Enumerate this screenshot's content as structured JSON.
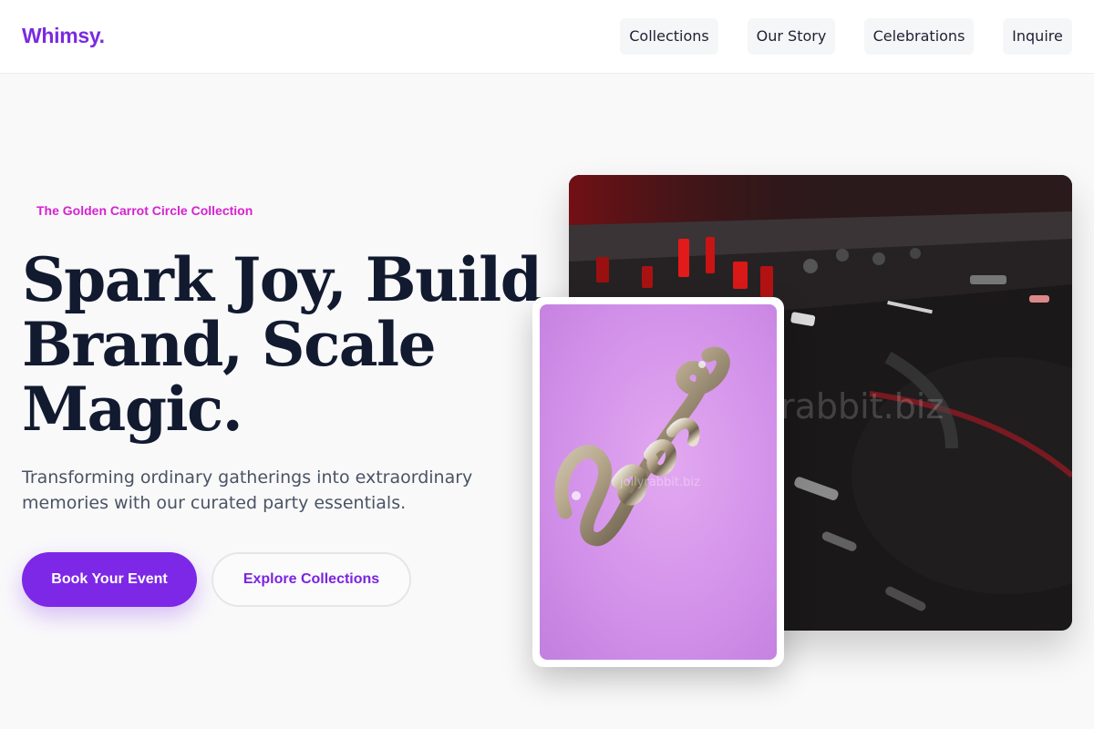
{
  "brand": {
    "logo": "Whimsy."
  },
  "nav": {
    "items": [
      {
        "label": "Collections"
      },
      {
        "label": "Our Story"
      },
      {
        "label": "Celebrations"
      },
      {
        "label": "Inquire"
      }
    ]
  },
  "hero": {
    "eyebrow": "The Golden Carrot Circle Collection",
    "headline": "Spark Joy, Build Brand, Scale Magic.",
    "subtext": "Transforming ordinary gatherings into extraordinary memories with our curated party essentials.",
    "primary_cta": "Book Your Event",
    "secondary_cta": "Explore Collections"
  },
  "images": {
    "main": {
      "subject": "dj-mixer-photo",
      "watermark": "rabbit.biz"
    },
    "inset": {
      "subject": "cheers-balloon-photo",
      "watermark": "jollyrabbit.biz"
    }
  },
  "colors": {
    "accent": "#7d28e6",
    "eyebrow": "#d622cf",
    "headline": "#121a30",
    "body_text": "#4a5364",
    "background": "#f9f9fa"
  }
}
